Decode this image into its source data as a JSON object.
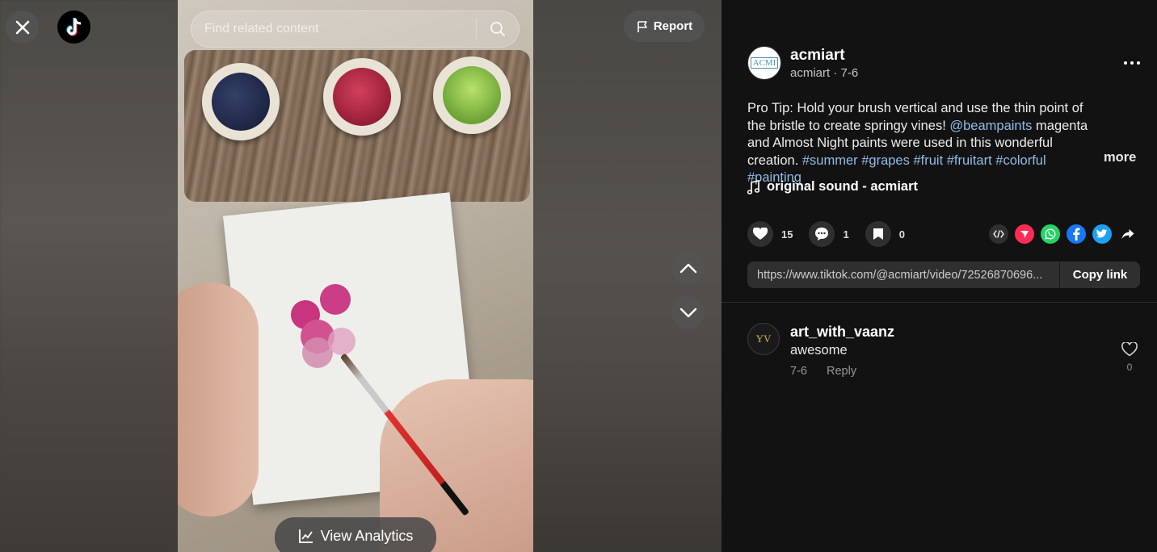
{
  "top": {
    "search_placeholder": "Find related content",
    "report_label": "Report",
    "icons": [
      "close-icon",
      "tiktok-logo",
      "search-icon",
      "flag-icon",
      "chevron-up-icon",
      "chevron-down-icon",
      "chart-icon"
    ]
  },
  "video": {
    "view_analytics_label": "View Analytics"
  },
  "post": {
    "author_name": "acmiart",
    "author_meta": "acmiart · 7-6",
    "avatar_text": "ACMI",
    "description_plain_1": "Pro Tip: Hold your brush vertical and use the thin point of the bristle to create springy vines! ",
    "description_mention": "@beampaints",
    "description_plain_2": " magenta and Almost Night paints were used in this wonderful creation. ",
    "hashtags": [
      "#summer",
      "#grapes",
      "#fruit",
      "#fruitart",
      "#colorful",
      "#painting"
    ],
    "more_label": "more",
    "sound": "original sound - acmiart",
    "likes": "15",
    "comments": "1",
    "saves": "0",
    "share_icons": [
      "embed-icon",
      "send-icon",
      "whatsapp-icon",
      "facebook-icon",
      "twitter-icon",
      "share-arrow-icon"
    ],
    "link": "https://www.tiktok.com/@acmiart/video/72526870696...",
    "copy_link_label": "Copy link"
  },
  "comments": [
    {
      "author": "art_with_vaanz",
      "avatar_text": "YV",
      "text": "awesome",
      "date": "7-6",
      "reply_label": "Reply",
      "likes": "0"
    }
  ],
  "colors": {
    "panel_bg": "#121212",
    "link": "#8fbce6",
    "send_red": "#fe2c55",
    "whatsapp": "#25d366",
    "facebook": "#1877f2",
    "twitter": "#1da1f2"
  }
}
